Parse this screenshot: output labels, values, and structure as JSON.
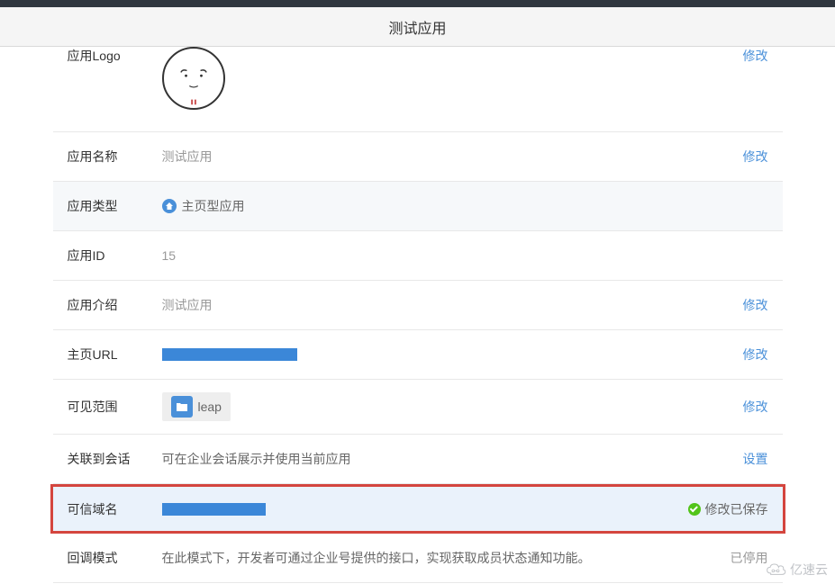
{
  "header": {
    "title": "测试应用"
  },
  "rows": {
    "logo": {
      "label": "应用Logo",
      "action": "修改"
    },
    "name": {
      "label": "应用名称",
      "value": "测试应用",
      "action": "修改"
    },
    "type": {
      "label": "应用类型",
      "value": "主页型应用"
    },
    "id": {
      "label": "应用ID",
      "value": "15"
    },
    "intro": {
      "label": "应用介绍",
      "value": "测试应用",
      "action": "修改"
    },
    "url": {
      "label": "主页URL",
      "action": "修改"
    },
    "range": {
      "label": "可见范围",
      "tag": "leap",
      "action": "修改"
    },
    "session": {
      "label": "关联到会话",
      "value": "可在企业会话展示并使用当前应用",
      "action": "设置"
    },
    "domain": {
      "label": "可信域名",
      "status": "修改已保存"
    },
    "callback": {
      "label": "回调模式",
      "value": "在此模式下，开发者可通过企业号提供的接口，实现获取成员状态通知功能。",
      "status": "已停用"
    }
  },
  "watermark": "亿速云"
}
